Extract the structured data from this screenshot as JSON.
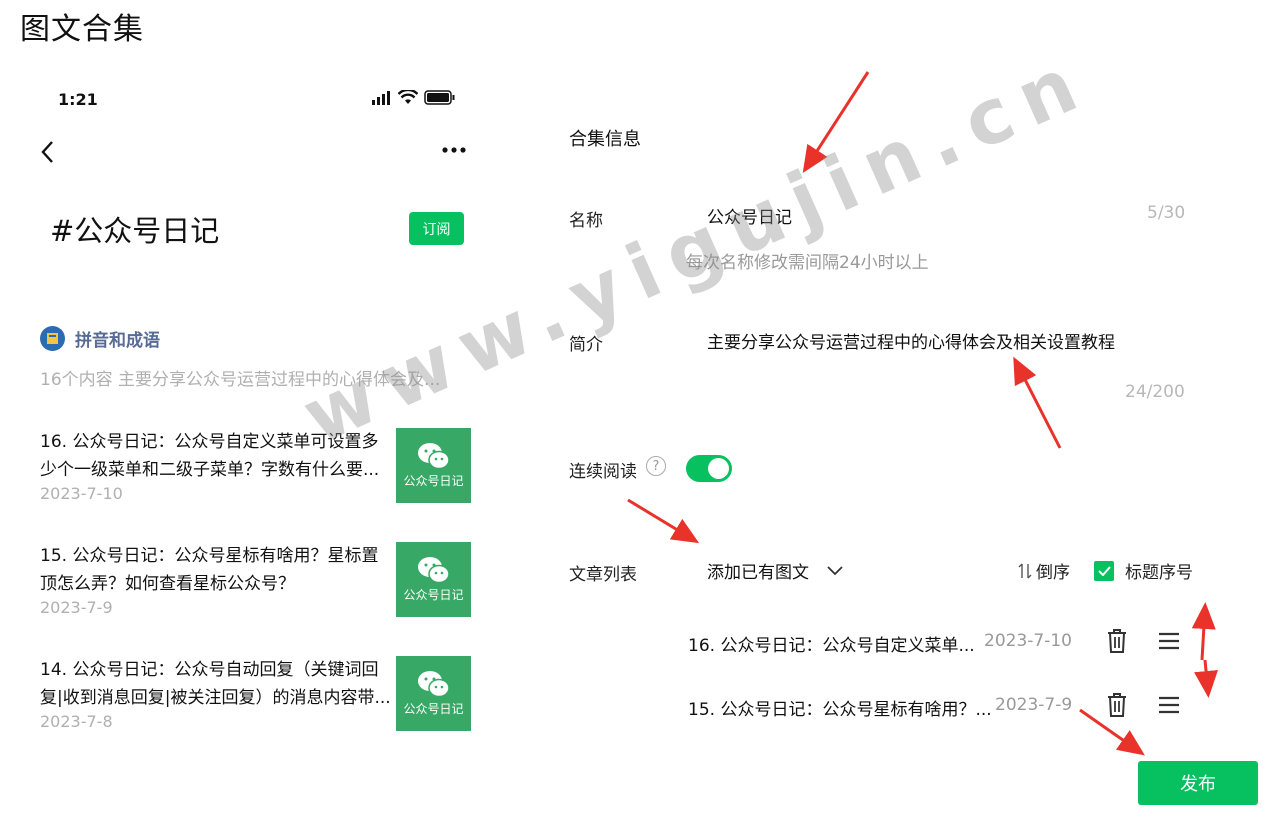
{
  "page": {
    "title": "图文合集"
  },
  "phone": {
    "status_time": "1:21",
    "hashtag": "#公众号日记",
    "subscribe_label": "订阅",
    "account_name": "拼音和成语",
    "account_desc": "16个内容  主要分享公众号运营过程中的心得体会及...",
    "articles": [
      {
        "title": "16. 公众号日记：公众号自定义菜单可设置多少个一级菜单和二级子菜单？字数有什么要...",
        "date": "2023-7-10",
        "thumb_text": "公众号日记"
      },
      {
        "title": "15. 公众号日记：公众号星标有啥用？星标置顶怎么弄？如何查看星标公众号？",
        "date": "2023-7-9",
        "thumb_text": "公众号日记"
      },
      {
        "title": "14. 公众号日记：公众号自动回复（关键词回复|收到消息回复|被关注回复）的消息内容带...",
        "date": "2023-7-8",
        "thumb_text": "公众号日记"
      }
    ]
  },
  "form": {
    "section_title": "合集信息",
    "name_label": "名称",
    "name_value": "公众号日记",
    "name_count": "5/30",
    "name_hint": "每次名称修改需间隔24小时以上",
    "intro_label": "简介",
    "intro_value": "主要分享公众号运营过程中的心得体会及相关设置教程",
    "intro_count": "24/200",
    "continuous_label": "连续阅读",
    "continuous_on": true,
    "list_label": "文章列表",
    "add_label": "添加已有图文",
    "sort_label": "倒序",
    "numbering_label": "标题序号",
    "items": [
      {
        "title": "16. 公众号日记：公众号自定义菜单...",
        "date": "2023-7-10"
      },
      {
        "title": "15. 公众号日记：公众号星标有啥用？...",
        "date": "2023-7-9"
      }
    ],
    "publish_label": "发布"
  },
  "watermark": "www.yigujin.cn",
  "colors": {
    "accent": "#07c160",
    "thumb": "#37a865",
    "arrow": "#e8322a",
    "account": "#576b95"
  }
}
